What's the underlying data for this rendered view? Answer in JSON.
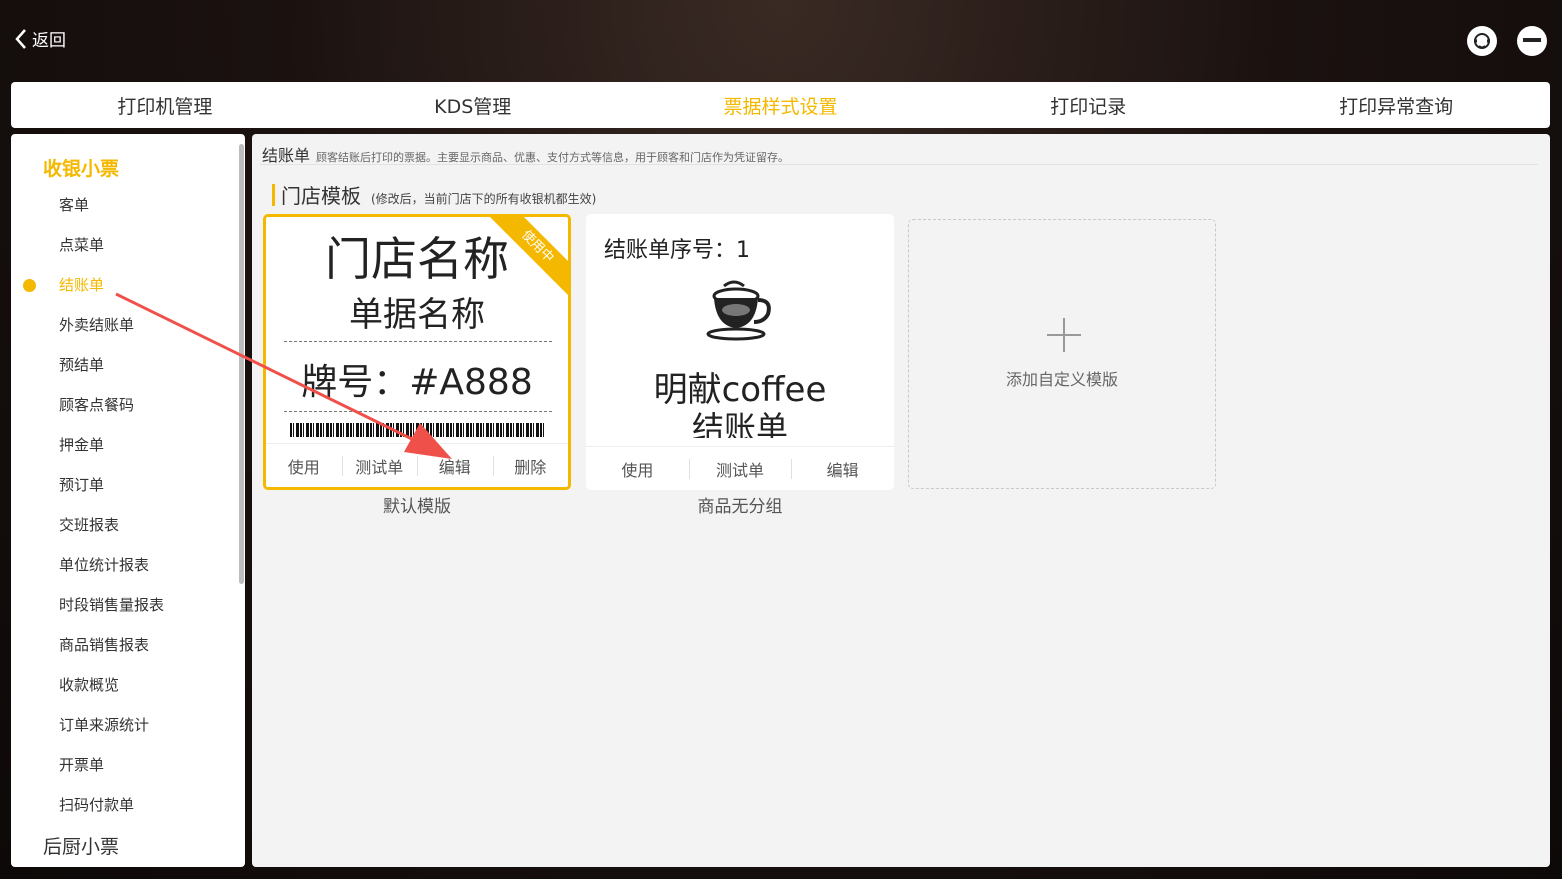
{
  "topbar": {
    "back_label": "返回"
  },
  "tabs": [
    {
      "label": "打印机管理",
      "active": false
    },
    {
      "label": "KDS管理",
      "active": false
    },
    {
      "label": "票据样式设置",
      "active": true
    },
    {
      "label": "打印记录",
      "active": false
    },
    {
      "label": "打印异常查询",
      "active": false
    }
  ],
  "sidebar": {
    "group_title": "收银小票",
    "items": [
      "客单",
      "点菜单",
      "结账单",
      "外卖结账单",
      "预结单",
      "顾客点餐码",
      "押金单",
      "预订单",
      "交班报表",
      "单位统计报表",
      "时段销售量报表",
      "商品销售报表",
      "收款概览",
      "订单来源统计",
      "开票单",
      "扫码付款单"
    ],
    "active_item": "结账单",
    "bottom_group_title": "后厨小票"
  },
  "main": {
    "title": "结账单",
    "description": "顾客结账后打印的票据。主要显示商品、优惠、支付方式等信息，用于顾客和门店作为凭证留存。",
    "section_title": "门店模板",
    "section_note": "(修改后，当前门店下的所有收银机都生效)"
  },
  "templates": [
    {
      "caption": "默认模版",
      "in_use_badge": "使用中",
      "store_name": "门店名称",
      "bill_name": "单据名称",
      "number_line": "牌号：#A888",
      "actions": [
        "使用",
        "测试单",
        "编辑",
        "删除"
      ]
    },
    {
      "caption": "商品无分组",
      "sequence_line": "结账单序号：1",
      "brand": "明献coffee",
      "bill_name": "结账单",
      "actions": [
        "使用",
        "测试单",
        "编辑"
      ]
    }
  ],
  "add_template_label": "添加自定义模版",
  "colors": {
    "accent": "#f5b800",
    "annotation_arrow": "#f0504a"
  },
  "icons": [
    "back-chevron-icon",
    "customer-support-icon",
    "minimize-icon",
    "coffee-cup-icon",
    "plus-icon"
  ]
}
